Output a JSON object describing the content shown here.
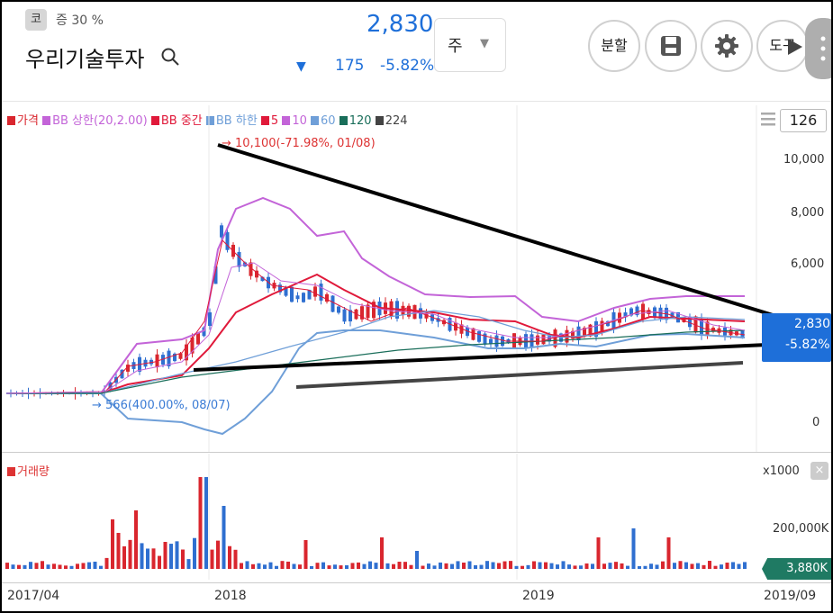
{
  "header": {
    "market_badge": "코",
    "margin_rate": "증 30 %",
    "stock_name": "우리기술투자",
    "price": "2,830",
    "change_amount": "175",
    "change_percent": "-5.82%",
    "period_option": "주",
    "split_button": "분할",
    "tools_button": "도구",
    "down_arrow": "▼",
    "colors": {
      "down": "#1e6fd9",
      "up": "#d33"
    }
  },
  "legend": [
    {
      "label": "가격",
      "color": "#d9262e"
    },
    {
      "label": "BB 상한(20,2.00)",
      "color": "#c364d8"
    },
    {
      "label": "BB 중간",
      "color": "#e0193a"
    },
    {
      "label": "BB 하한",
      "color": "#6f9fd8"
    },
    {
      "label": "5",
      "color": "#e0193a"
    },
    {
      "label": "10",
      "color": "#c364d8"
    },
    {
      "label": "60",
      "color": "#6f9fd8"
    },
    {
      "label": "120",
      "color": "#1a6e5a"
    },
    {
      "label": "224",
      "color": "#444444"
    }
  ],
  "candle_count": "126",
  "annotations": {
    "high": "→ 10,100(-71.98%, 01/08)",
    "low": "→ 566(400.00%, 08/07)"
  },
  "price_axis": [
    "10,000",
    "8,000",
    "6,000",
    "0"
  ],
  "price_tag": {
    "price": "2,830",
    "percent": "-5.82%"
  },
  "volume": {
    "title": "거래량",
    "unit": "x1000",
    "close": "×",
    "axis": [
      "200,000K"
    ],
    "current": "3,880K"
  },
  "dates": [
    "2017/04",
    "2018",
    "2019",
    "2019/09"
  ],
  "chart_data": {
    "type": "candlestick",
    "title": "",
    "ylim": [
      0,
      11000
    ],
    "y_ticks": [
      0,
      6000,
      8000,
      10000
    ],
    "x_labels": [
      "2017/04",
      "2018",
      "2019",
      "2019/09"
    ],
    "last_price": 2830,
    "change": -175,
    "change_percent": -5.82,
    "period_high": {
      "value": 10100,
      "date": "01/08",
      "percent": -71.98
    },
    "period_low": {
      "value": 566,
      "date": "08/07",
      "percent": 400.0
    },
    "volume_ticks": [
      "200,000K"
    ],
    "last_volume": "3,880K",
    "series": [
      {
        "name": "가격"
      },
      {
        "name": "BB 상한(20,2.00)"
      },
      {
        "name": "BB 중간"
      },
      {
        "name": "BB 하한"
      },
      {
        "name": "5"
      },
      {
        "name": "10"
      },
      {
        "name": "60"
      },
      {
        "name": "120"
      },
      {
        "name": "224"
      }
    ],
    "grid": true
  }
}
